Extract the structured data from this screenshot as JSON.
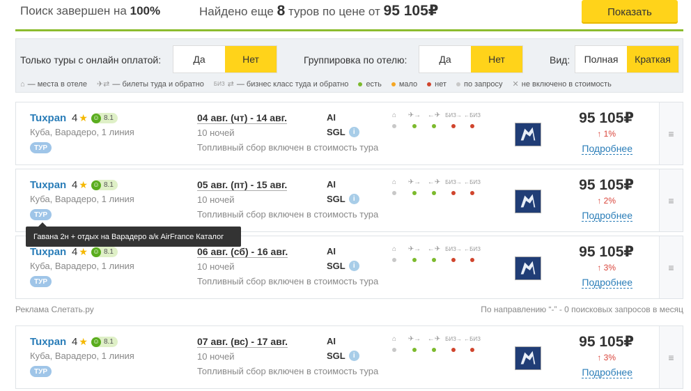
{
  "header": {
    "search_prefix": "Поиск завершен на",
    "search_percent": "100%",
    "found_prefix": "Найдено еще",
    "found_count": "8",
    "found_middle": "туров по цене от",
    "found_price": "95 105₽",
    "show_button": "Показать"
  },
  "filters": {
    "online_label": "Только туры с онлайн оплатой:",
    "online_yes": "Да",
    "online_no": "Нет",
    "group_label": "Группировка по отелю:",
    "group_yes": "Да",
    "group_no": "Нет",
    "view_label": "Вид:",
    "view_full": "Полная",
    "view_short": "Краткая"
  },
  "legend": {
    "hotel": "— места в отеле",
    "tickets": "— билеты туда и обратно",
    "business": "— бизнес класс туда и обратно",
    "yes": "есть",
    "few": "мало",
    "no": "нет",
    "on_request": "по запросу",
    "not_included": "не включено в стоимость",
    "colors": {
      "yes": "#7cba2d",
      "few": "#f5a623",
      "no": "#d0452d",
      "on_request": "#c8c8c8"
    }
  },
  "tours": [
    {
      "hotel": "Tuxpan",
      "stars": "4",
      "rating": "8.1",
      "location": "Куба, Варадеро, 1 линия",
      "badge": "ТУР",
      "dates": "04 авг. (чт) - 14 авг.",
      "nights": "10 ночей",
      "fuel": "Топливный сбор включен в стоимость тура",
      "meal": "AI",
      "room": "SGL",
      "price": "95 105₽",
      "change": "↑ 1%",
      "details": "Подробнее"
    },
    {
      "hotel": "Tuxpan",
      "stars": "4",
      "rating": "8.1",
      "location": "Куба, Варадеро, 1 линия",
      "badge": "ТУР",
      "dates": "05 авг. (пт) - 15 авг.",
      "nights": "10 ночей",
      "fuel": "Топливный сбор включен в стоимость тура",
      "meal": "AI",
      "room": "SGL",
      "price": "95 105₽",
      "change": "↑ 2%",
      "details": "Подробнее"
    },
    {
      "hotel": "Tuxpan",
      "stars": "4",
      "rating": "8.1",
      "location": "Куба, Варадеро, 1 линия",
      "badge": "ТУР",
      "dates": "06 авг. (сб) - 16 авг.",
      "nights": "10 ночей",
      "fuel": "Топливный сбор включен в стоимость тура",
      "meal": "AI",
      "room": "SGL",
      "price": "95 105₽",
      "change": "↑ 3%",
      "details": "Подробнее"
    },
    {
      "hotel": "Tuxpan",
      "stars": "4",
      "rating": "8.1",
      "location": "Куба, Варадеро, 1 линия",
      "badge": "ТУР",
      "dates": "07 авг. (вс) - 17 авг.",
      "nights": "10 ночей",
      "fuel": "Топливный сбор включен в стоимость тура",
      "meal": "AI",
      "room": "SGL",
      "price": "95 105₽",
      "change": "↑ 3%",
      "details": "Подробнее"
    }
  ],
  "services": {
    "biz_label": "БИЗ"
  },
  "tooltip": "Гавана 2н + отдых на Варадеро а/к AirFrance Каталог",
  "ad": {
    "left": "Реклама Слетать.ру",
    "right": "По направлению “-” - 0 поисковых запросов в месяц"
  }
}
